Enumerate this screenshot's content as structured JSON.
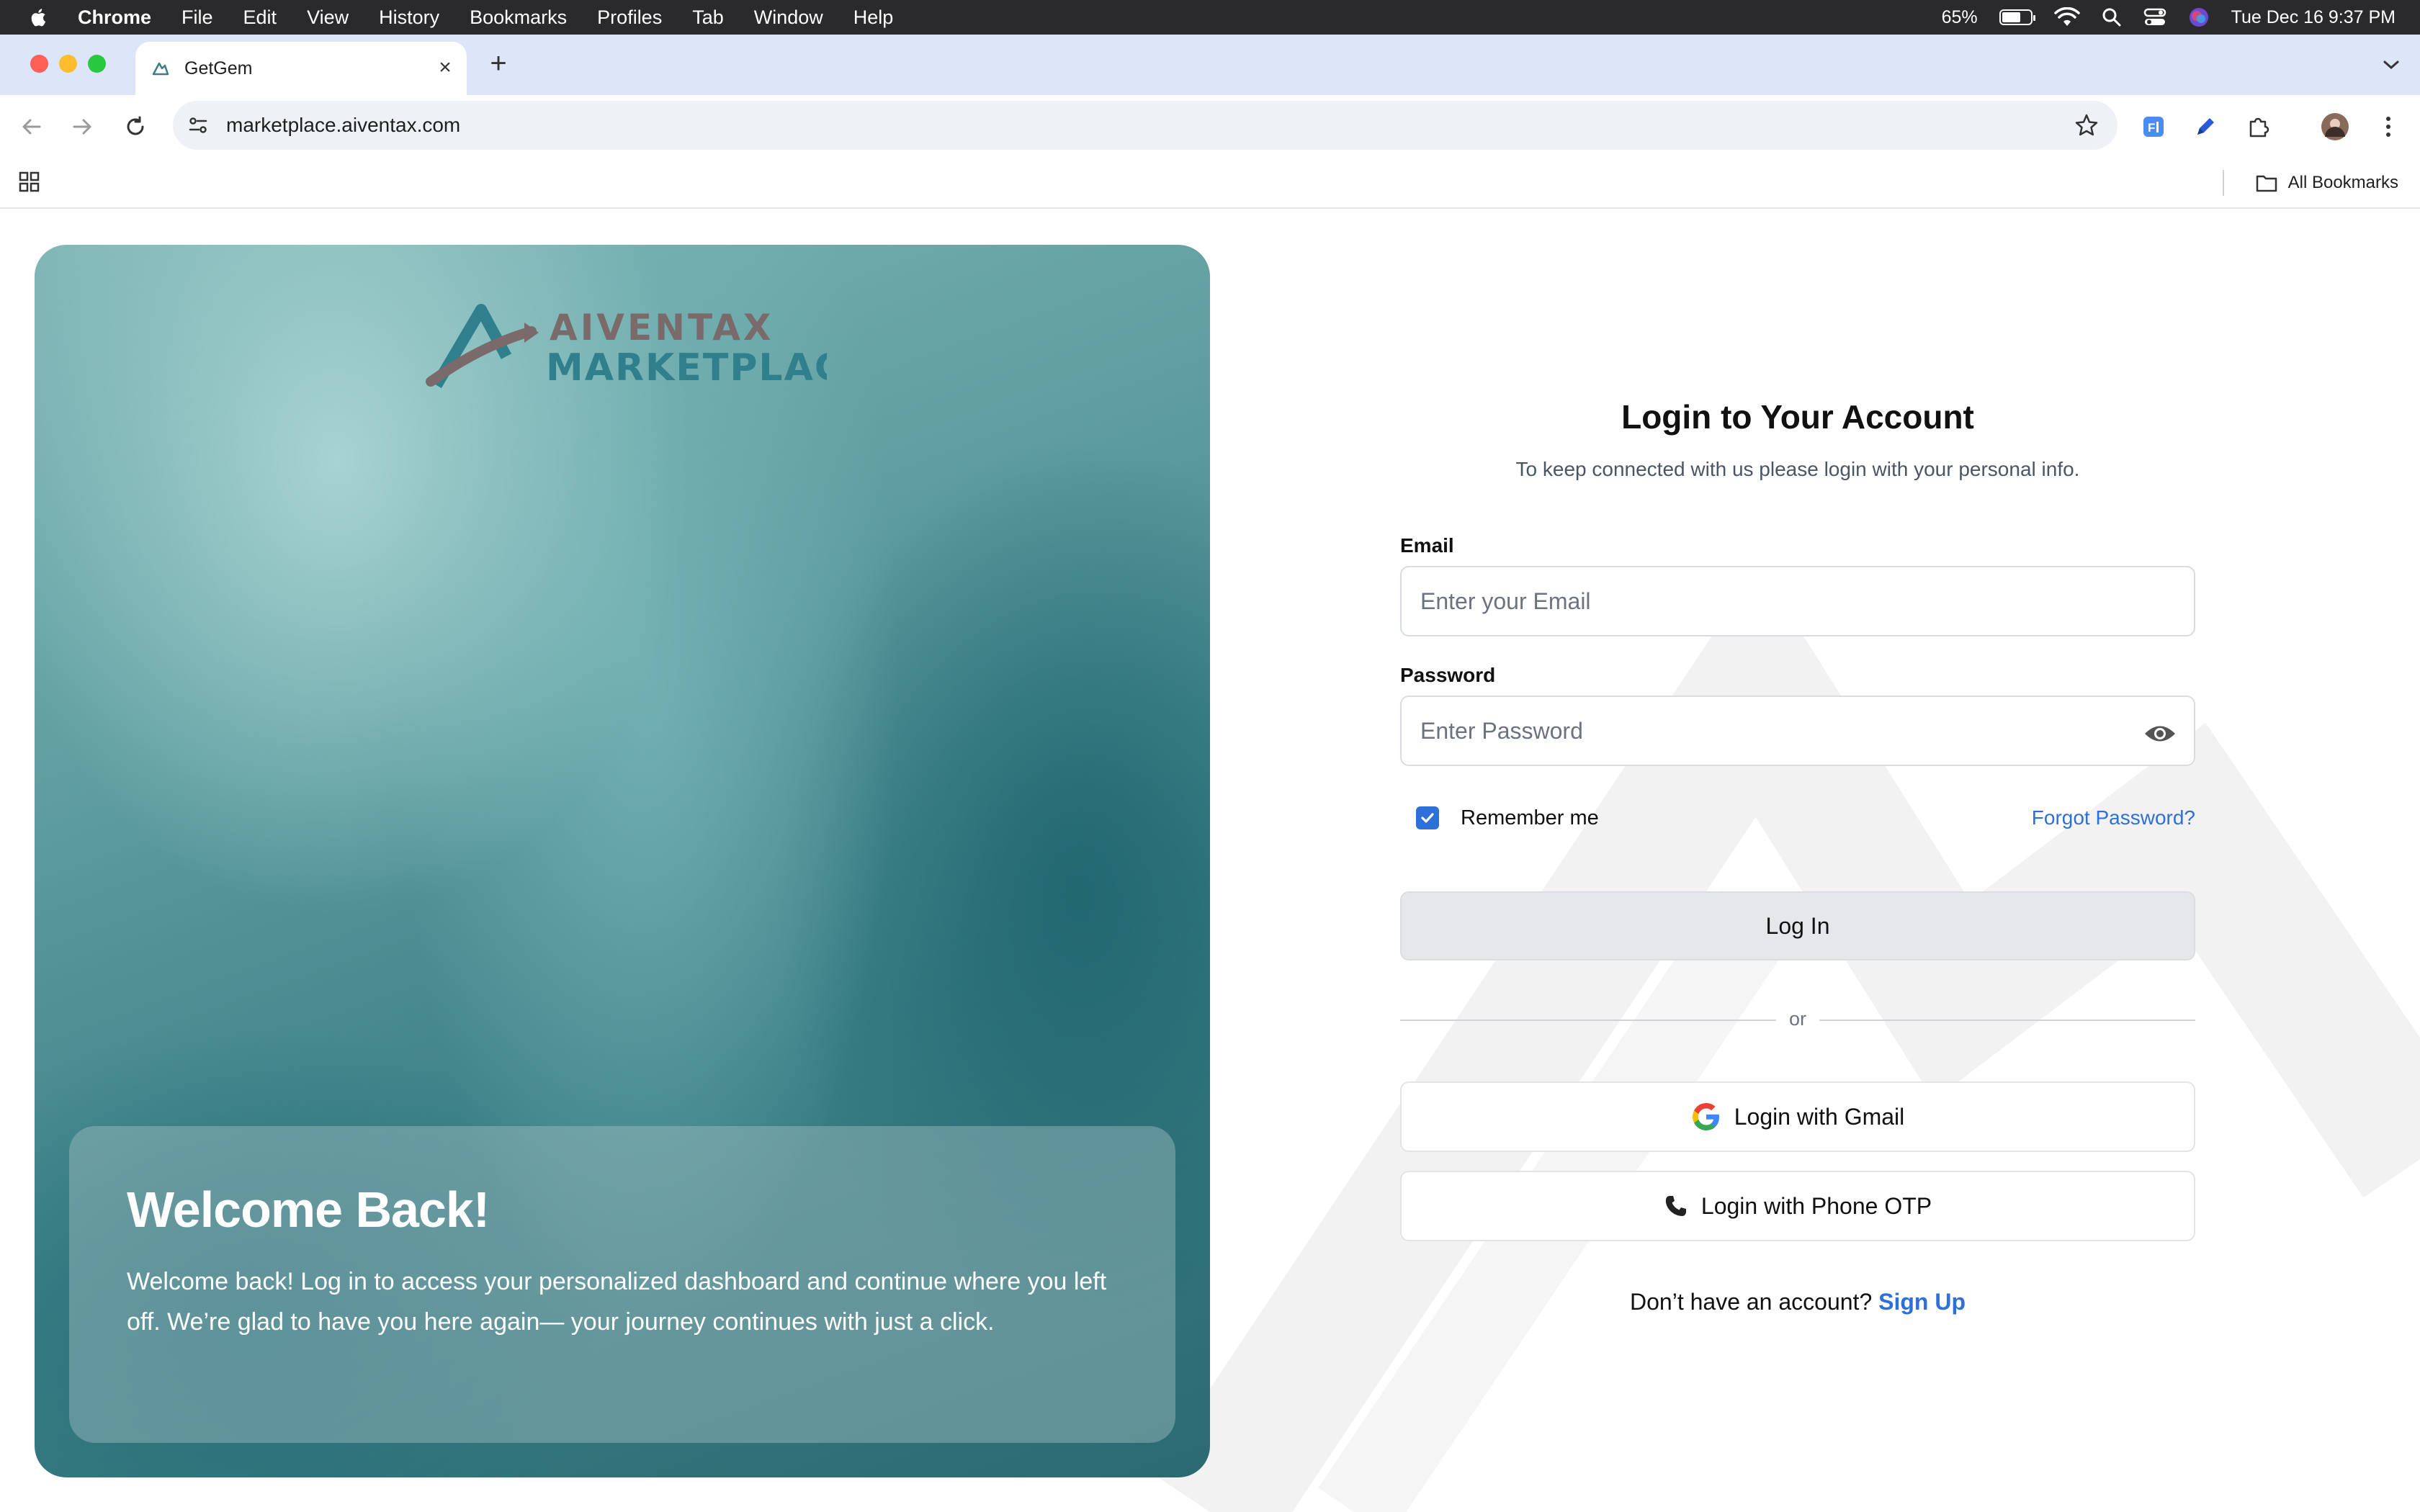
{
  "menubar": {
    "app_name": "Chrome",
    "items": [
      "File",
      "Edit",
      "View",
      "History",
      "Bookmarks",
      "Profiles",
      "Tab",
      "Window",
      "Help"
    ],
    "battery_text": "65%",
    "battery_level": 0.65,
    "datetime": "Tue Dec 16  9:37 PM"
  },
  "browser": {
    "tab_title": "GetGem",
    "url": "marketplace.aiventax.com",
    "bookmarks_all": "All Bookmarks"
  },
  "hero": {
    "logo_line1": "AIVENTAX",
    "logo_line2": "MARKETPLACE",
    "heading": "Welcome Back!",
    "body": "Welcome back! Log in to access your personalized dashboard and continue where you left off. We’re glad to have you here again— your journey continues with just a click."
  },
  "login": {
    "title": "Login to Your Account",
    "subtitle": "To keep connected with us please login with your personal info.",
    "email_label": "Email",
    "email_placeholder": "Enter your Email",
    "password_label": "Password",
    "password_placeholder": "Enter Password",
    "remember_label": "Remember me",
    "remember_checked": true,
    "forgot_label": "Forgot Password?",
    "login_button": "Log In",
    "or_text": "or",
    "gmail_button": "Login with Gmail",
    "phone_button": "Login with Phone OTP",
    "signup_prompt": "Don’t have an account?",
    "signup_link": "Sign Up"
  },
  "colors": {
    "accent": "#2f6fd8",
    "hero_teal": "#3b7f86",
    "logo_grey": "#7a6a6a"
  }
}
